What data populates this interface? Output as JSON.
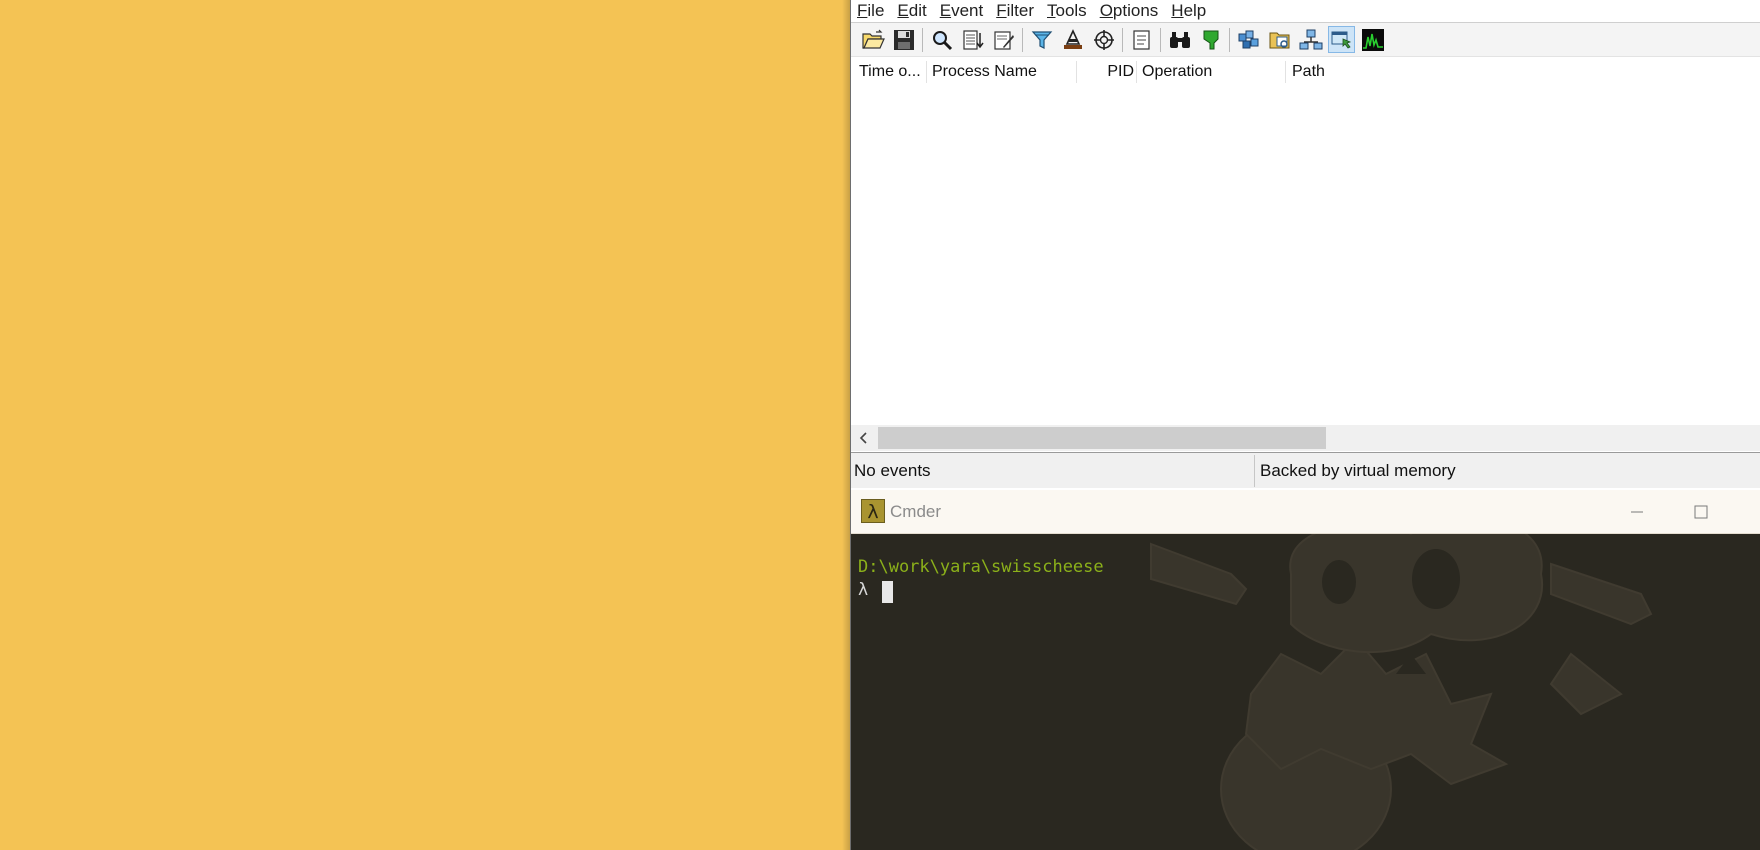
{
  "procmon": {
    "menu": [
      "File",
      "Edit",
      "Event",
      "Filter",
      "Tools",
      "Options",
      "Help"
    ],
    "toolbar_icons": [
      "open-icon",
      "save-icon",
      "magnify-icon",
      "autoscroll-icon",
      "clear-icon",
      "filter-icon",
      "highlight-icon",
      "target-icon",
      "tree-icon",
      "find-icon",
      "jump-icon",
      "registry-activity-icon",
      "file-activity-icon",
      "network-activity-icon",
      "process-activity-icon",
      "profiling-activity-icon"
    ],
    "columns": [
      "Time o...",
      "Process Name",
      "PID",
      "Operation",
      "Path"
    ],
    "status_left": "No events",
    "status_right": "Backed by virtual memory",
    "colors": {
      "toolbar_active": "#cde4f7"
    }
  },
  "cmder": {
    "logo": "λ",
    "title": "Cmder",
    "path_line": "D:\\work\\yara\\swisscheese",
    "prompt": "λ",
    "colors": {
      "path": "#8bb01a",
      "background": "#2a2820"
    }
  },
  "desktop": {
    "color": "#f4c354"
  }
}
